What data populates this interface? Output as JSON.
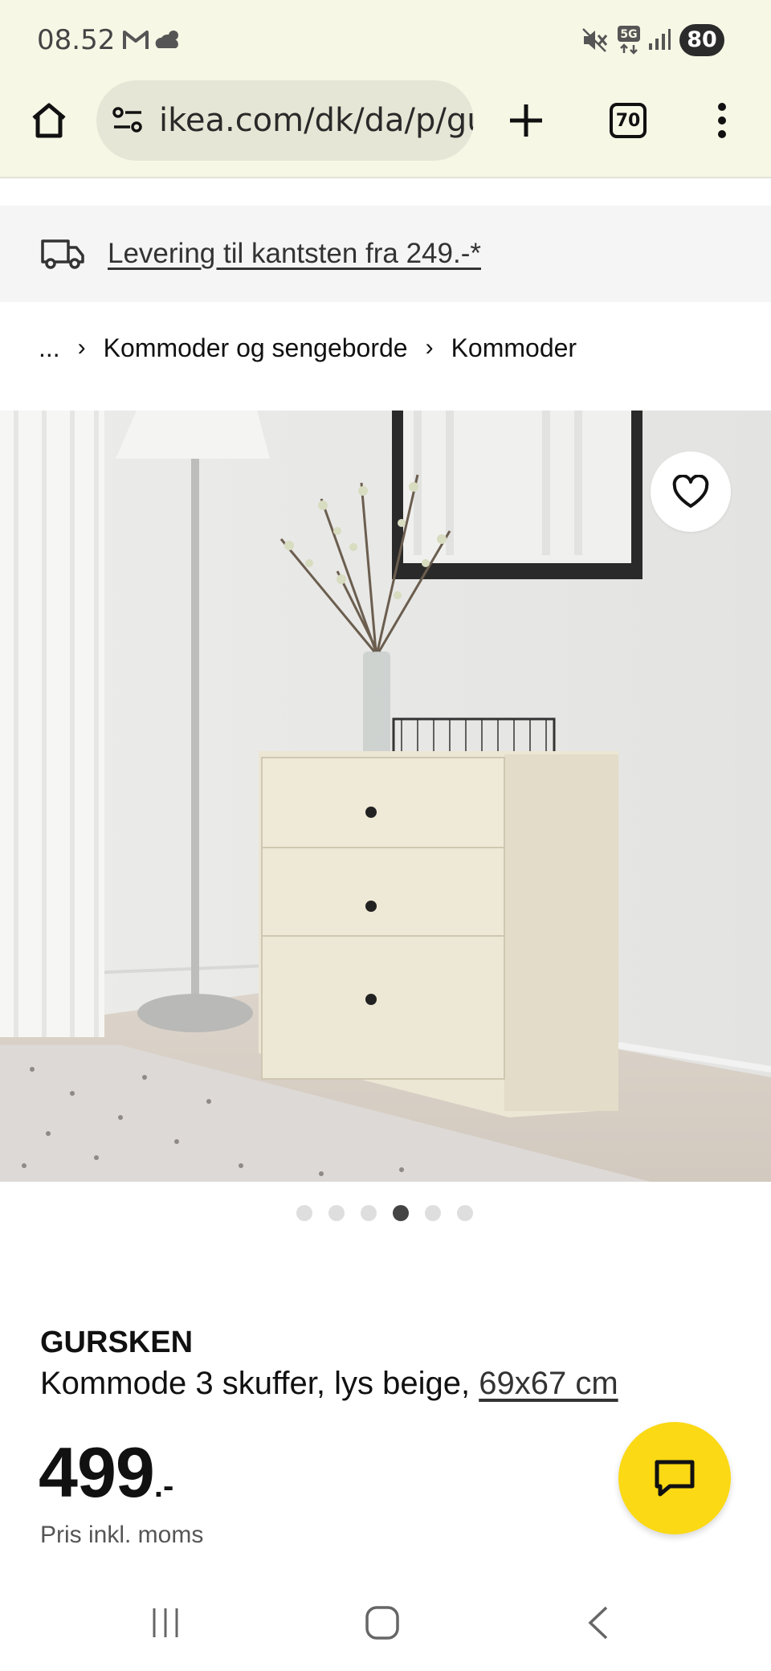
{
  "status_bar": {
    "time": "08.52",
    "network": "5G",
    "battery": "80"
  },
  "browser": {
    "url": "ikea.com/dk/da/p/gur",
    "tab_count": "70"
  },
  "banner": {
    "text": "Levering til kantsten fra 249.-*"
  },
  "breadcrumb": {
    "ellipsis": "...",
    "items": [
      "Kommoder og sengeborde",
      "Kommoder"
    ]
  },
  "gallery": {
    "image_count": 6,
    "active_index": 3
  },
  "product": {
    "name": "GURSKEN",
    "description": "Kommode 3 skuffer, lys beige, ",
    "dimensions": "69x67 cm",
    "price": "499",
    "price_suffix": ".-",
    "vat_note": "Pris inkl. moms"
  },
  "colors": {
    "chrome_bg": "#f7f7e6",
    "chat_button": "#fbd914"
  }
}
